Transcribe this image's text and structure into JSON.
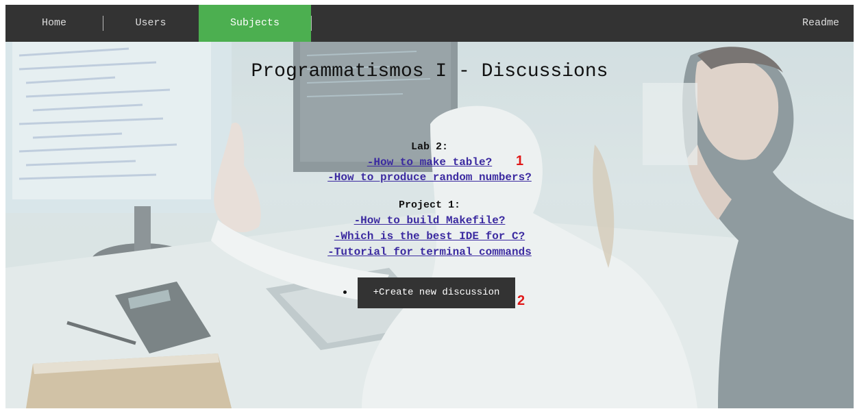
{
  "nav": {
    "home": "Home",
    "users": "Users",
    "subjects": "Subjects",
    "readme": "Readme",
    "active_color": "#4caf50",
    "bar_color": "#333333"
  },
  "page": {
    "title": "Programmatismos I - Discussions"
  },
  "sections": [
    {
      "heading": "Lab 2:",
      "links": [
        "-How to make table?",
        "-How to produce random numbers?"
      ]
    },
    {
      "heading": "Project 1:",
      "links": [
        "-How to build Makefile?",
        "-Which is the best IDE for C?",
        "-Tutorial for terminal commands"
      ]
    }
  ],
  "actions": {
    "create_label": "+Create new discussion"
  },
  "annotations": {
    "marker_1": "1",
    "marker_2": "2",
    "color": "#e01818"
  },
  "colors": {
    "link": "#3b2aa0"
  }
}
